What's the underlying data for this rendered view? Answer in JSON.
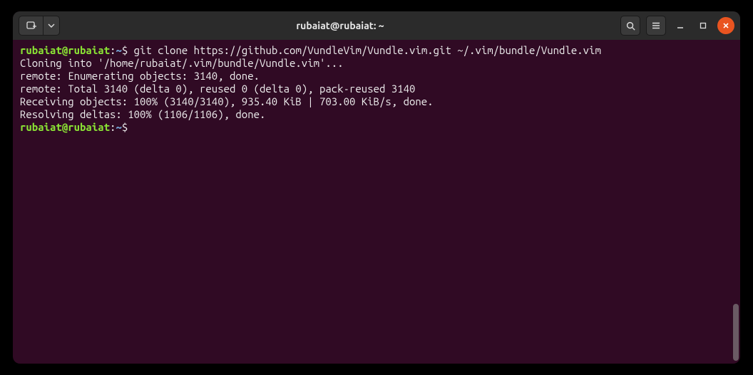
{
  "titlebar": {
    "title": "rubaiat@rubaiat: ~"
  },
  "prompt": {
    "user": "rubaiat",
    "at": "@",
    "host": "rubaiat",
    "colon": ":",
    "path": "~",
    "symbol": "$"
  },
  "session": {
    "command1": " git clone https://github.com/VundleVim/Vundle.vim.git ~/.vim/bundle/Vundle.vim",
    "output": [
      "Cloning into '/home/rubaiat/.vim/bundle/Vundle.vim'...",
      "remote: Enumerating objects: 3140, done.",
      "remote: Total 3140 (delta 0), reused 0 (delta 0), pack-reused 3140",
      "Receiving objects: 100% (3140/3140), 935.40 KiB | 703.00 KiB/s, done.",
      "Resolving deltas: 100% (1106/1106), done."
    ],
    "command2": " "
  },
  "icons": {
    "newtab": "new-tab-icon",
    "dropdown": "chevron-down-icon",
    "search": "search-icon",
    "menu": "hamburger-icon",
    "minimize": "minimize-icon",
    "maximize": "maximize-icon",
    "close": "close-icon"
  }
}
